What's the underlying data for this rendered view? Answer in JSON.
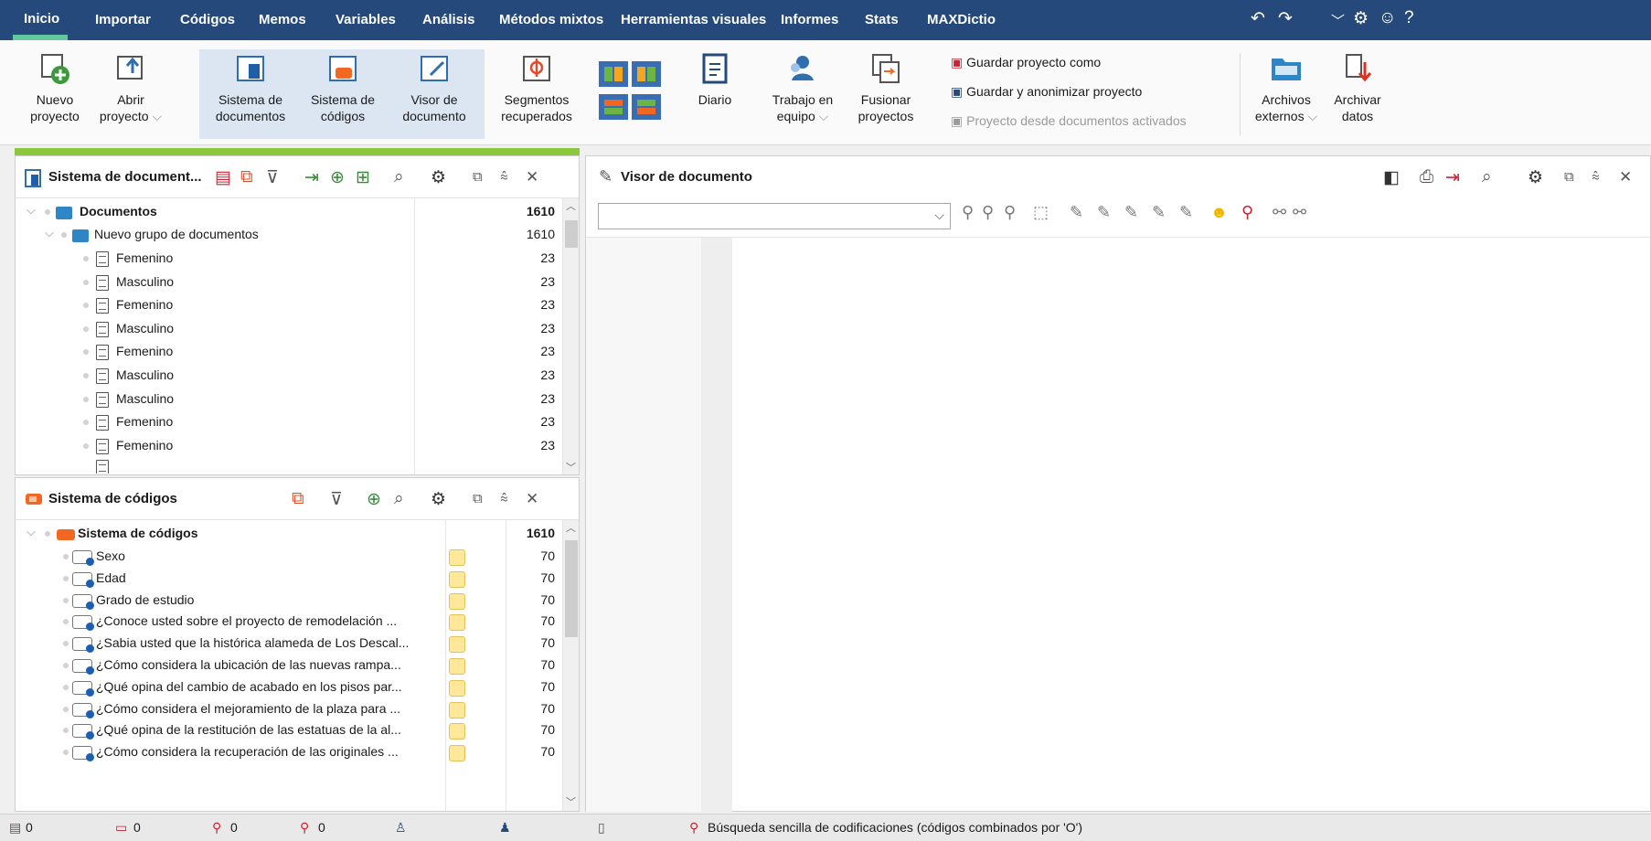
{
  "menu": {
    "tabs": [
      "Inicio",
      "Importar",
      "Códigos",
      "Memos",
      "Variables",
      "Análisis",
      "Métodos mixtos",
      "Herramientas visuales",
      "Informes",
      "Stats",
      "MAXDictio"
    ]
  },
  "ribbon": {
    "new_project": [
      "Nuevo",
      "proyecto"
    ],
    "open_project": [
      "Abrir",
      "proyecto"
    ],
    "doc_system": [
      "Sistema de",
      "documentos"
    ],
    "code_system": [
      "Sistema de",
      "códigos"
    ],
    "doc_viewer": [
      "Visor de",
      "documento"
    ],
    "retrieved": [
      "Segmentos",
      "recuperados"
    ],
    "diary": "Diario",
    "teamwork": [
      "Trabajo en",
      "equipo"
    ],
    "merge": [
      "Fusionar",
      "proyectos"
    ],
    "save_as": "Guardar proyecto como",
    "save_anon": "Guardar y anonimizar proyecto",
    "from_activated": "Proyecto desde documentos activados",
    "external": [
      "Archivos",
      "externos"
    ],
    "archive": [
      "Archivar",
      "datos"
    ]
  },
  "doc_panel": {
    "title": "Sistema de document...",
    "root_label": "Documentos",
    "root_count": "1610",
    "group_label": "Nuevo grupo de documentos",
    "group_count": "1610",
    "items": [
      {
        "label": "Femenino",
        "count": "23"
      },
      {
        "label": "Masculino",
        "count": "23"
      },
      {
        "label": "Femenino",
        "count": "23"
      },
      {
        "label": "Masculino",
        "count": "23"
      },
      {
        "label": "Femenino",
        "count": "23"
      },
      {
        "label": "Masculino",
        "count": "23"
      },
      {
        "label": "Masculino",
        "count": "23"
      },
      {
        "label": "Femenino",
        "count": "23"
      },
      {
        "label": "Femenino",
        "count": "23"
      }
    ]
  },
  "code_panel": {
    "title": "Sistema de códigos",
    "root_label": "Sistema de códigos",
    "root_count": "1610",
    "items": [
      {
        "label": "Sexo",
        "count": "70"
      },
      {
        "label": "Edad",
        "count": "70"
      },
      {
        "label": "Grado de estudio",
        "count": "70"
      },
      {
        "label": "¿Conoce usted sobre el proyecto de remodelación ...",
        "count": "70"
      },
      {
        "label": "¿Sabia usted que la histórica alameda de Los Descal...",
        "count": "70"
      },
      {
        "label": "¿Cómo considera la ubicación de las nuevas rampa...",
        "count": "70"
      },
      {
        "label": "¿Qué opina del cambio de acabado en los pisos par...",
        "count": "70"
      },
      {
        "label": "¿Cómo considera el mejoramiento de la plaza para ...",
        "count": "70"
      },
      {
        "label": "¿Qué opina de la restitución de las estatuas de la al...",
        "count": "70"
      },
      {
        "label": "¿Cómo considera la recuperación de las originales ...",
        "count": "70"
      }
    ]
  },
  "viewer": {
    "title": "Visor de documento",
    "combo_value": ""
  },
  "status": {
    "docs": "0",
    "codes": "0",
    "segments": "0",
    "vars": "0",
    "message": "Búsqueda sencilla de codificaciones (códigos combinados por 'O')"
  },
  "colors": {
    "menubar": "#24497a",
    "accent_green": "#8dc63f",
    "selected_ribbon": "#dce6f2",
    "code_orange": "#f26722"
  }
}
